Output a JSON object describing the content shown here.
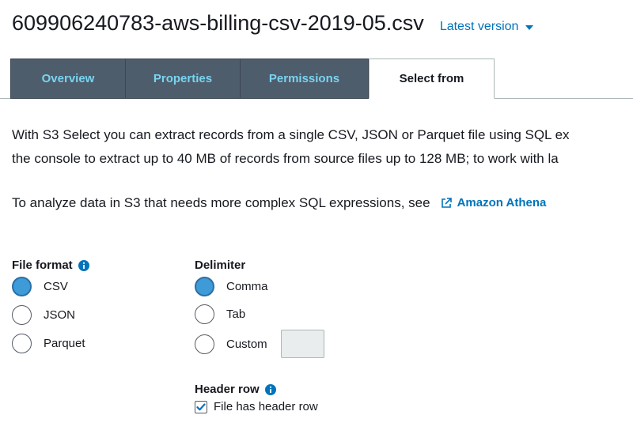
{
  "header": {
    "file_name": "609906240783-aws-billing-csv-2019-05.csv",
    "version_label": "Latest version"
  },
  "tabs": [
    {
      "label": "Overview",
      "active": false
    },
    {
      "label": "Properties",
      "active": false
    },
    {
      "label": "Permissions",
      "active": false
    },
    {
      "label": "Select from",
      "active": true
    }
  ],
  "description": {
    "line1": "With S3 Select you can extract records from a single CSV, JSON or Parquet file using SQL ex",
    "line2": "the console to extract up to 40 MB of records from source files up to 128 MB; to work with la",
    "line3": "To analyze data in S3 that needs more complex SQL expressions, see",
    "athena_link": "Amazon Athena"
  },
  "file_format": {
    "label": "File format",
    "options": [
      {
        "label": "CSV",
        "checked": true
      },
      {
        "label": "JSON",
        "checked": false
      },
      {
        "label": "Parquet",
        "checked": false
      }
    ]
  },
  "delimiter": {
    "label": "Delimiter",
    "options": [
      {
        "label": "Comma",
        "checked": true
      },
      {
        "label": "Tab",
        "checked": false
      },
      {
        "label": "Custom",
        "checked": false
      }
    ],
    "custom_value": ""
  },
  "header_row": {
    "label": "Header row",
    "checkbox_label": "File has header row",
    "checked": true
  },
  "colors": {
    "accent": "#0073bb",
    "tab_bg": "#4e5d6c",
    "tab_text": "#79d4f1",
    "radio_checked": "#3e9bd8"
  }
}
